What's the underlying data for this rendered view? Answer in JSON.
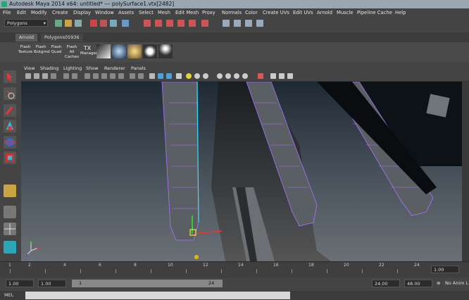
{
  "window": {
    "title": "Autodesk Maya 2014 x64: untitled*   ---   polySurface1.vtx[2482]"
  },
  "menubar": {
    "items": [
      "File",
      "Edit",
      "Modify",
      "Create",
      "Display",
      "Window",
      "Assets",
      "Select",
      "Mesh",
      "Edit Mesh",
      "Proxy",
      "Normals",
      "Color",
      "Create UVs",
      "Edit UVs",
      "Arnold",
      "Muscle",
      "Pipeline Cache",
      "Help"
    ]
  },
  "status_line": {
    "mode": "Polygons"
  },
  "shelf": {
    "tabs": [
      "Arnold",
      "Polygons05936"
    ],
    "buttons": [
      {
        "line1": "Flash",
        "line2": "Texture"
      },
      {
        "line1": "Flash",
        "line2": "Bckgrnd"
      },
      {
        "line1": "Flash",
        "line2": "Quad"
      },
      {
        "line1": "Flash",
        "line2": "All Caches"
      },
      {
        "line1": "TX",
        "line2": "Manager"
      }
    ]
  },
  "panel": {
    "menus": [
      "View",
      "Shading",
      "Lighting",
      "Show",
      "Renderer",
      "Panels"
    ]
  },
  "timeline": {
    "ticks": [
      "1",
      "2",
      "4",
      "6",
      "8",
      "10",
      "12",
      "14",
      "16",
      "18",
      "20",
      "22",
      "24"
    ],
    "current_frame": "1.00"
  },
  "range": {
    "start": "1.00",
    "playback_start": "1.00",
    "slider_start": "1",
    "slider_end": "24",
    "playback_end": "24.00",
    "end": "48.00",
    "anim_layer": "No Anim L"
  },
  "command_line": {
    "label": "MEL"
  },
  "colors": {
    "accent": "#e5b800",
    "viewport_top": "#1f2933",
    "mesh_wire": "#b070ff"
  }
}
